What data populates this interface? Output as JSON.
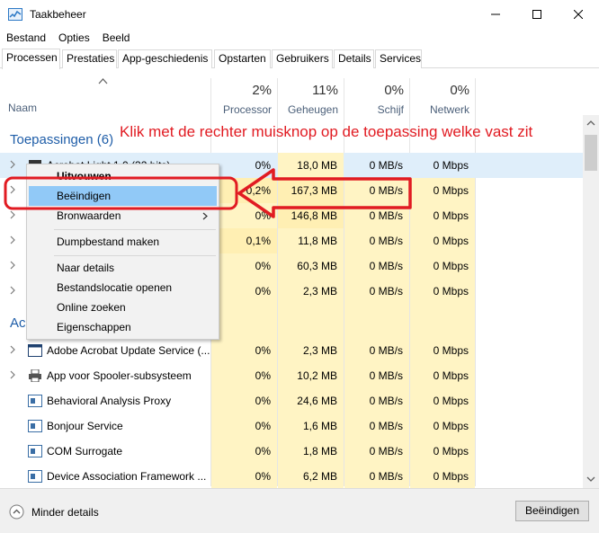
{
  "window": {
    "title": "Taakbeheer"
  },
  "menu": [
    "Bestand",
    "Opties",
    "Beeld"
  ],
  "tabs": [
    "Processen",
    "Prestaties",
    "App-geschiedenis",
    "Opstarten",
    "Gebruikers",
    "Details",
    "Services"
  ],
  "columns": {
    "name": "Naam",
    "cpu": {
      "pct": "2%",
      "label": "Processor"
    },
    "mem": {
      "pct": "11%",
      "label": "Geheugen"
    },
    "disk": {
      "pct": "0%",
      "label": "Schijf"
    },
    "net": {
      "pct": "0%",
      "label": "Netwerk"
    }
  },
  "groups": {
    "apps": "Toepassingen (6)",
    "background": "Ac"
  },
  "app_rows": [
    {
      "name": "Acrobat Light 1.0 (32 bits)",
      "cpu": "0%",
      "mem": "18,0 MB",
      "disk": "0 MB/s",
      "net": "0 Mbps"
    },
    {
      "name": "",
      "cpu": "0,2%",
      "mem": "167,3 MB",
      "disk": "0 MB/s",
      "net": "0 Mbps"
    },
    {
      "name": "",
      "cpu": "0%",
      "mem": "146,8 MB",
      "disk": "0 MB/s",
      "net": "0 Mbps"
    },
    {
      "name": "",
      "cpu": "0,1%",
      "mem": "11,8 MB",
      "disk": "0 MB/s",
      "net": "0 Mbps"
    },
    {
      "name": "",
      "cpu": "0%",
      "mem": "60,3 MB",
      "disk": "0 MB/s",
      "net": "0 Mbps"
    },
    {
      "name": "",
      "cpu": "0%",
      "mem": "2,3 MB",
      "disk": "0 MB/s",
      "net": "0 Mbps"
    }
  ],
  "bg_rows": [
    {
      "name": "Adobe Acrobat Update Service (...",
      "cpu": "0%",
      "mem": "2,3 MB",
      "disk": "0 MB/s",
      "net": "0 Mbps"
    },
    {
      "name": "App voor Spooler-subsysteem",
      "cpu": "0%",
      "mem": "10,2 MB",
      "disk": "0 MB/s",
      "net": "0 Mbps"
    },
    {
      "name": "Behavioral Analysis Proxy",
      "cpu": "0%",
      "mem": "24,6 MB",
      "disk": "0 MB/s",
      "net": "0 Mbps"
    },
    {
      "name": "Bonjour Service",
      "cpu": "0%",
      "mem": "1,6 MB",
      "disk": "0 MB/s",
      "net": "0 Mbps"
    },
    {
      "name": "COM Surrogate",
      "cpu": "0%",
      "mem": "1,8 MB",
      "disk": "0 MB/s",
      "net": "0 Mbps"
    },
    {
      "name": "Device Association Framework ...",
      "cpu": "0%",
      "mem": "6,2 MB",
      "disk": "0 MB/s",
      "net": "0 Mbps"
    }
  ],
  "context_menu": {
    "items": [
      "Uitvouwen",
      "Beëindigen",
      "Bronwaarden",
      "Dumpbestand maken",
      "Naar details",
      "Bestandslocatie openen",
      "Online zoeken",
      "Eigenschappen"
    ]
  },
  "annotation": "Klik met de rechter muisknop op de toepassing welke vast zit",
  "footer": {
    "less_details": "Minder details",
    "end_task": "Beëindigen"
  },
  "colors": {
    "accent": "#1e5da8",
    "highlight": "#91c9f7",
    "annotation": "#e11b22",
    "cell_bg": "#fff4c4"
  }
}
